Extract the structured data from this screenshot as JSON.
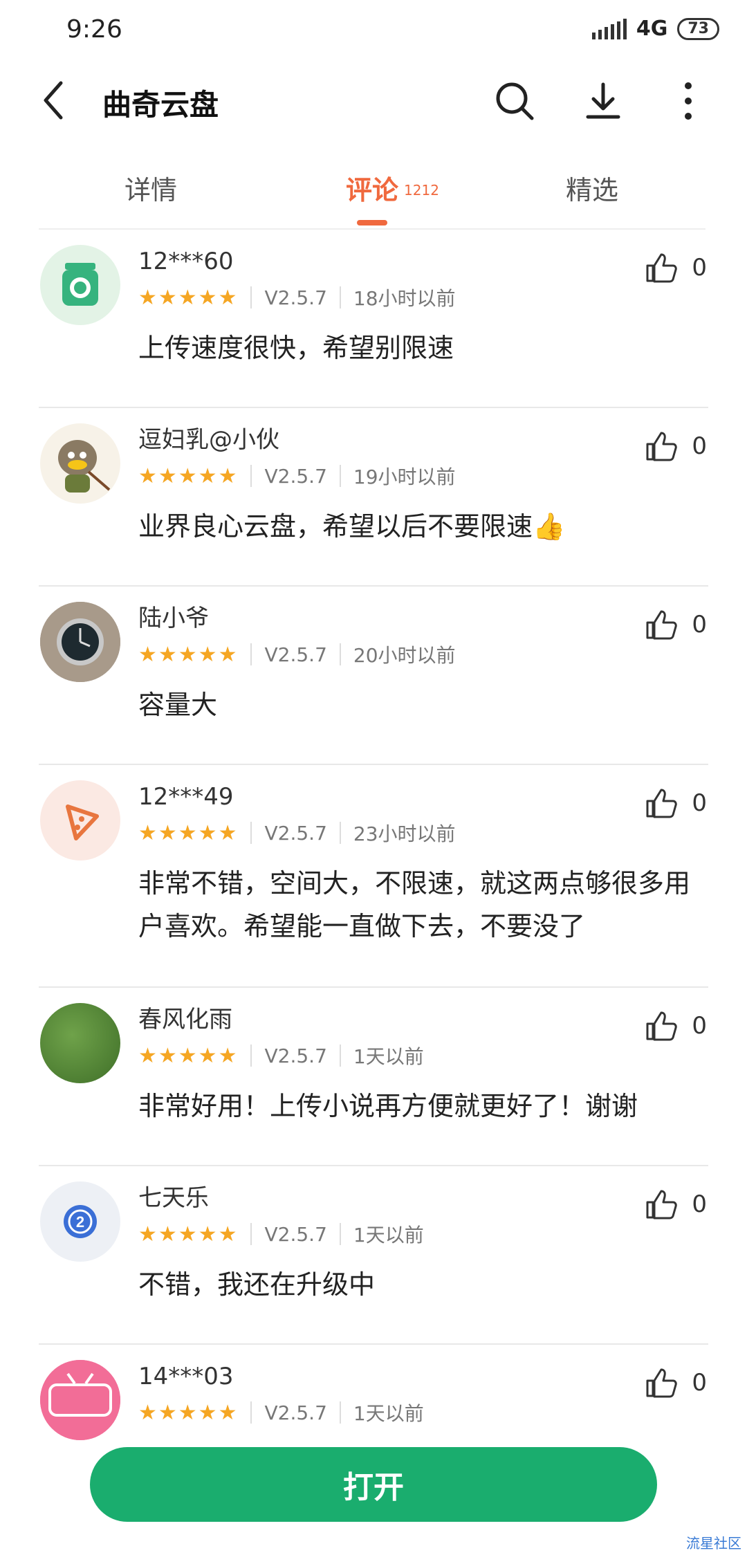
{
  "status_bar": {
    "time": "9:26",
    "network": "4G",
    "battery": "73"
  },
  "header": {
    "title": "曲奇云盘",
    "icons": [
      "back-icon",
      "search-icon",
      "download-icon",
      "more-icon"
    ]
  },
  "tabs": {
    "details": "详情",
    "comments": "评论",
    "comments_count": "1212",
    "featured": "精选"
  },
  "colors": {
    "accent": "#f0693e",
    "star": "#f5a623",
    "open_button": "#1aad6e"
  },
  "reviews": [
    {
      "user": "12***60",
      "stars": "★★★★★",
      "version": "V2.5.7",
      "time": "18小时以前",
      "text": "上传速度很快，希望别限速",
      "likes": "0"
    },
    {
      "user": "逗妇乳@小伙",
      "stars": "★★★★★",
      "version": "V2.5.7",
      "time": "19小时以前",
      "text": "业界良心云盘，希望以后不要限速👍",
      "likes": "0"
    },
    {
      "user": "陆小爷",
      "stars": "★★★★★",
      "version": "V2.5.7",
      "time": "20小时以前",
      "text": "容量大",
      "likes": "0"
    },
    {
      "user": "12***49",
      "stars": "★★★★★",
      "version": "V2.5.7",
      "time": "23小时以前",
      "text": "非常不错，空间大，不限速，就这两点够很多用户喜欢。希望能一直做下去，不要没了",
      "likes": "0"
    },
    {
      "user": "春风化雨",
      "stars": "★★★★★",
      "version": "V2.5.7",
      "time": "1天以前",
      "text": "非常好用！上传小说再方便就更好了！谢谢",
      "likes": "0"
    },
    {
      "user": "七天乐",
      "stars": "★★★★★",
      "version": "V2.5.7",
      "time": "1天以前",
      "text": "不错，我还在升级中",
      "likes": "0"
    },
    {
      "user": "14***03",
      "stars": "★★★★★",
      "version": "V2.5.7",
      "time": "1天以前",
      "text": "",
      "likes": "0"
    }
  ],
  "open_button_label": "打开",
  "watermark": "流星社区"
}
